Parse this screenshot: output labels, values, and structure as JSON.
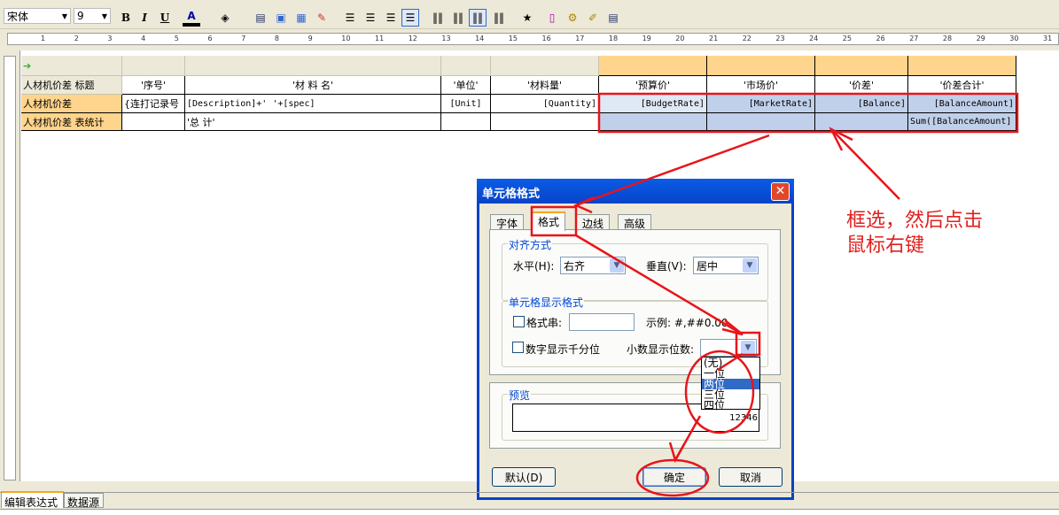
{
  "toolbar": {
    "font": "宋体",
    "size": "9",
    "bold": "B",
    "italic": "I",
    "underline": "U",
    "font_color": "A"
  },
  "ruler": [
    "1",
    "2",
    "3",
    "4",
    "5",
    "6",
    "7",
    "8",
    "9",
    "10",
    "11",
    "12",
    "13",
    "14",
    "15",
    "16",
    "17",
    "18",
    "19",
    "20",
    "21",
    "22",
    "23",
    "24",
    "25",
    "26",
    "27",
    "28",
    "29",
    "30",
    "31"
  ],
  "grid": {
    "columns": [
      "'序号'",
      "'材  料  名'",
      "'单位'",
      "'材料量'",
      "'预算价'",
      "'市场价'",
      "'价差'",
      "'价差合计'"
    ],
    "rows": [
      {
        "label": "人材机价差 标题",
        "cells": [
          "'序号'",
          "'材  料  名'",
          "'单位'",
          "'材料量'",
          "'预算价'",
          "'市场价'",
          "'价差'",
          "'价差合计'"
        ]
      },
      {
        "label": "人材机价差",
        "cells": [
          "{连打记录号",
          "[Description]+' '+[spec]",
          "[Unit]",
          "[Quantity]",
          "[BudgetRate]",
          "[MarketRate]",
          "[Balance]",
          "[BalanceAmount]"
        ]
      },
      {
        "label": "人材机价差 表统计",
        "cells": [
          "",
          "'总  计'",
          "",
          "",
          "",
          "",
          "",
          "Sum([BalanceAmount]"
        ]
      }
    ]
  },
  "dialog": {
    "title": "单元格格式",
    "tabs": [
      "字体",
      "格式",
      "边线",
      "高级"
    ],
    "active_tab": "格式",
    "align_group": "对齐方式",
    "horizontal_label": "水平(H):",
    "horizontal_value": "右齐",
    "vertical_label": "垂直(V):",
    "vertical_value": "居中",
    "display_group": "单元格显示格式",
    "format_string_label": "格式串:",
    "format_string_value": "",
    "example": "示例: #,##0.00",
    "thousands_label": "数字显示千分位",
    "decimals_label": "小数显示位数:",
    "decimals_value": "",
    "decimals_options": [
      "(无)",
      "一位",
      "两位",
      "三位",
      "四位"
    ],
    "decimals_highlighted": "两位",
    "preview_group": "预览",
    "preview_value": "12346",
    "default_button": "默认(D)",
    "ok_button": "确定",
    "cancel_button": "取消"
  },
  "annotation": {
    "line1": "框选，然后点击",
    "line2": "鼠标右键"
  },
  "bottom_tabs": [
    "编辑表达式",
    "数据源"
  ],
  "colors": {
    "annotation": "#e0201e",
    "selection": "#c0d0ea",
    "band": "#ffd48c",
    "title_bar": "#0a5ce6"
  }
}
